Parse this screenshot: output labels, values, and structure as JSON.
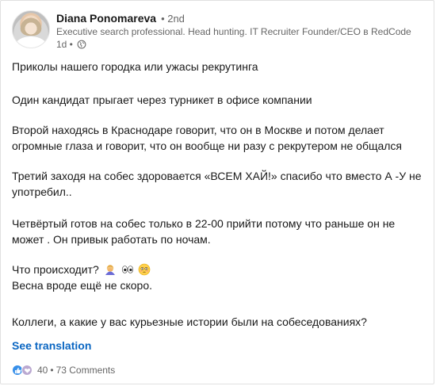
{
  "author": {
    "name": "Diana Ponomareva",
    "degree": "• 2nd",
    "headline": "Executive search professional. Head hunting. IT Recruiter Founder/CEO в RedCode",
    "time": "1d •"
  },
  "post": {
    "p1": "Приколы нашего городка или ужасы рекрутинга",
    "p2": "Один кандидат прыгает через турникет в офисе компании",
    "p3": "Второй находясь в Краснодаре говорит, что он в Москве и потом делает огромные глаза и говорит, что он вообще ни разу с рекрутером не общался",
    "p4": "Третий заходя на собес здоровается «ВСЕМ ХАЙ!» спасибо что вместо А -У не употребил..",
    "p5": "Четвёртый готов на собес только в 22-00 прийти потому что раньше он не может . Он привык работать по ночам.",
    "p6_line1": "Что происходит?",
    "p6_line2": "Весна вроде ещё не скоро.",
    "p7": "Коллеги, а какие у вас курьезные истории были на собеседованиях?"
  },
  "actions": {
    "see_translation": "See translation"
  },
  "social": {
    "reactions": "40",
    "separator": "•",
    "comments": "73 Comments"
  },
  "colors": {
    "link": "#0a66c2",
    "secondary_text": "#666666",
    "like": "#378fe9"
  },
  "icons": [
    "globe-icon",
    "facepalm-emoji",
    "eyes-emoji",
    "flushed-face-emoji",
    "like-reaction-icon",
    "support-reaction-icon"
  ]
}
